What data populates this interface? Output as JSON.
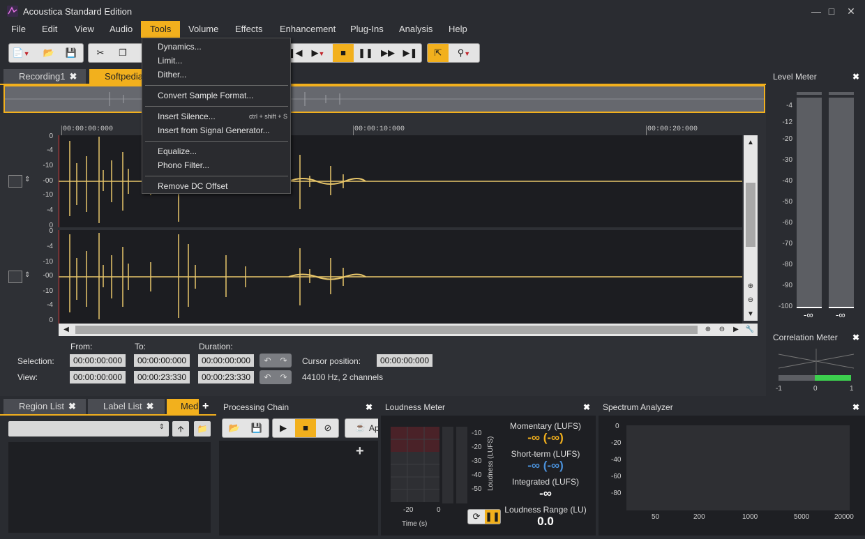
{
  "window": {
    "title": "Acoustica Standard Edition",
    "controls": [
      "minimize",
      "maximize",
      "close"
    ]
  },
  "menubar": [
    "File",
    "Edit",
    "View",
    "Audio",
    "Tools",
    "Volume",
    "Effects",
    "Enhancement",
    "Plug-Ins",
    "Analysis",
    "Help"
  ],
  "active_menu": "Tools",
  "tools_menu": {
    "items": [
      {
        "label": "Dynamics..."
      },
      {
        "label": "Limit..."
      },
      {
        "label": "Dither..."
      },
      {
        "label": "Convert Sample Format..."
      },
      {
        "label": "Insert Silence...",
        "shortcut": "ctrl + shift + S"
      },
      {
        "label": "Insert from Signal Generator..."
      },
      {
        "label": "Equalize..."
      },
      {
        "label": "Phono Filter..."
      },
      {
        "label": "Remove DC Offset"
      }
    ]
  },
  "tabs": {
    "documents": [
      "Recording1",
      "Softpedia"
    ],
    "active_document": "Softpedia"
  },
  "ruler": {
    "labels": [
      "00:00:00:000",
      "00:00:10:000",
      "00:00:20:000"
    ]
  },
  "db_scale": [
    "0",
    "-4",
    "-10",
    "-00",
    "-10",
    "-4",
    "0"
  ],
  "selection": {
    "from_label": "From:",
    "to_label": "To:",
    "duration_label": "Duration:",
    "selection_label": "Selection:",
    "view_label": "View:",
    "selection_from": "00:00:00:000",
    "selection_to": "00:00:00:000",
    "selection_duration": "00:00:00:000",
    "view_from": "00:00:00:000",
    "view_to": "00:00:23:330",
    "view_duration": "00:00:23:330",
    "cursor_label": "Cursor position:",
    "cursor_value": "00:00:00:000",
    "format": "44100 Hz, 2 channels"
  },
  "level_meter": {
    "title": "Level Meter",
    "scale": [
      "-4",
      "-12",
      "-20",
      "-30",
      "-40",
      "-50",
      "-60",
      "-70",
      "-80",
      "-90",
      "-100"
    ],
    "readouts": [
      "-∞",
      "-∞"
    ]
  },
  "correlation_meter": {
    "title": "Correlation Meter",
    "scale": [
      "-1",
      "0",
      "1"
    ]
  },
  "bottom_tabs": {
    "items": [
      "Region List",
      "Label List",
      "Media"
    ],
    "active": "Media"
  },
  "processing_chain": {
    "title": "Processing Chain",
    "apply_label": "Ap"
  },
  "loudness_meter": {
    "title": "Loudness Meter",
    "momentary_label": "Momentary (LUFS)",
    "momentary_value": "-∞ (-∞)",
    "shortterm_label": "Short-term (LUFS)",
    "shortterm_value": "-∞ (-∞)",
    "integrated_label": "Integrated (LUFS)",
    "integrated_value": "-∞",
    "range_label": "Loudness Range (LU)",
    "range_value": "0.0",
    "y_axis": [
      "-10",
      "-20",
      "-30",
      "-40",
      "-50"
    ],
    "y_label": "Loudness (LUFS)",
    "x_axis": [
      "-20",
      "0"
    ],
    "x_label": "Time (s)"
  },
  "spectrum_analyzer": {
    "title": "Spectrum Analyzer",
    "y_axis": [
      "0",
      "-20",
      "-40",
      "-60",
      "-80"
    ],
    "x_axis": [
      "50",
      "200",
      "1000",
      "5000",
      "20000"
    ]
  },
  "colors": {
    "accent": "#f2b01d",
    "waveform": "#e8c66a",
    "background": "#2a2c31",
    "momentary": "#f2b01d",
    "shortterm": "#4a90d9",
    "correlation": "#3ccf4e"
  }
}
